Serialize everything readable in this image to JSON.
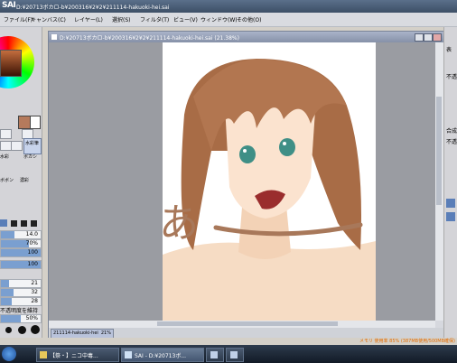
{
  "window": {
    "app_name": "SAI",
    "title": "D:¥20713ボカロ-b¥200316¥2¥2¥211114-hakuoki-hei.sai"
  },
  "menu": [
    "ファイル(F)",
    "キャンバス(C)",
    "レイヤー(L)",
    "選択(S)",
    "フィルタ(T)",
    "ビュー(V)",
    "ウィンドウ(W)",
    "その他(O)"
  ],
  "left_panel": {
    "sliders": [
      {
        "label": "14.0",
        "fill": 0.35
      },
      {
        "label": "70%",
        "fill": 0.7
      },
      {
        "label": "100",
        "fill": 1.0
      },
      {
        "label": "100",
        "fill": 1.0
      },
      {
        "label": "21",
        "fill": 0.21
      },
      {
        "label": "32",
        "fill": 0.32
      },
      {
        "label": "28",
        "fill": 0.28
      },
      {
        "label": "50%",
        "fill": 0.5
      }
    ],
    "texts": {
      "tool_a": "水彩筆",
      "tool_b": "ボカシ",
      "tool_c": "水彩",
      "tool_d": "ボボン",
      "tool_e": "濃彩",
      "keep_opacity": "不透明度を維持"
    },
    "brush_sizes": [
      "1",
      "1.5",
      "2",
      "2.3"
    ]
  },
  "document": {
    "title": "D:¥20713ボカロ-b¥200316¥2¥2¥211114-hakuoki-hei.sai (21.38%)",
    "tab_label": "211114-hakuoki-hei",
    "tab_zoom": "21%"
  },
  "canvas": {
    "handwritten_glyph": "あ"
  },
  "right_panel": {
    "texts": [
      "表",
      "不透",
      "合成",
      "不透"
    ]
  },
  "status": {
    "text": "メモリ 使用率 85% (387MB使用/500MB確保)"
  },
  "taskbar": {
    "items": [
      {
        "label": "【祭・】ニコ中毒..."
      },
      {
        "label": "SAI - D:¥20713ボ..."
      },
      {
        "label": ""
      },
      {
        "label": ""
      }
    ]
  },
  "colors": {
    "accent": "#7a9fd0",
    "skin": "#fbe3cf",
    "hair": "#a86c46",
    "eye": "#3f8f86",
    "status_orange": "#e36b00"
  }
}
